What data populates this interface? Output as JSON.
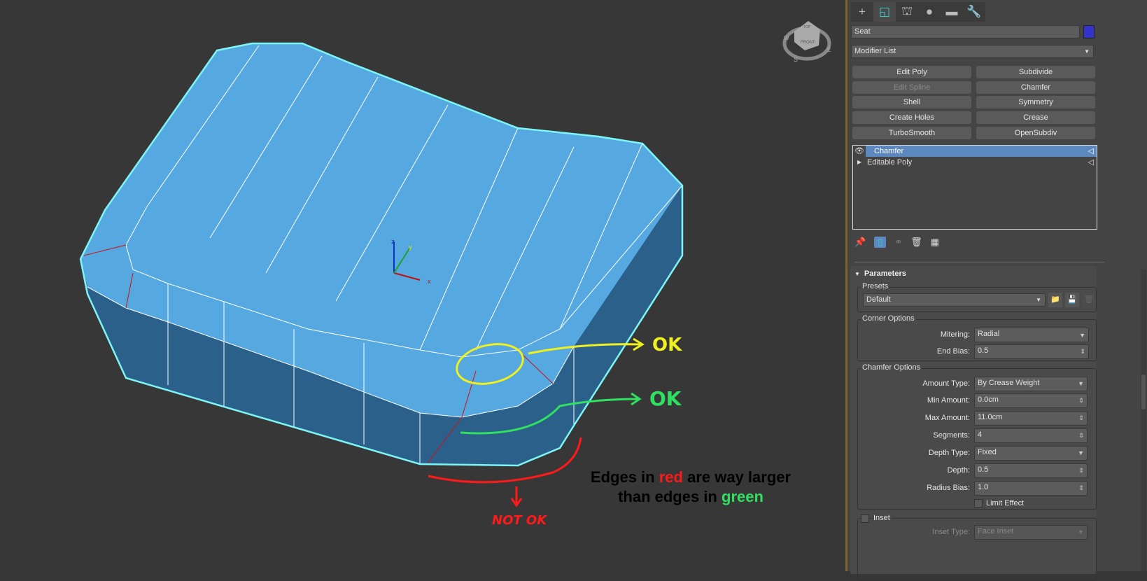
{
  "viewport": {
    "viewcube": {
      "face_top": "TOP",
      "face_front": "FRONT",
      "compass_w": "W",
      "compass_s": "S",
      "compass_e": "E"
    },
    "gizmo": {
      "x": "x",
      "y": "y",
      "z": "z"
    },
    "annotations": {
      "ok_yellow": "OK",
      "ok_green": "OK",
      "not_ok": "NOT OK",
      "note_part1": "Edges in ",
      "note_red": "red",
      "note_part2": " are way larger",
      "note_line2": "than edges in ",
      "note_green": "green"
    },
    "colors": {
      "top_face": "#56a8e0",
      "side_face": "#2a6089",
      "selection_outline": "#7ef5f5",
      "yellow": "#f0f020",
      "green": "#30e060",
      "red": "#ff1a1a"
    }
  },
  "panel": {
    "tabs": [
      {
        "icon": "plus-icon",
        "glyph": "+"
      },
      {
        "icon": "modify-icon",
        "glyph": "◱"
      },
      {
        "icon": "hierarchy-icon",
        "glyph": "⛫"
      },
      {
        "icon": "motion-icon",
        "glyph": "●"
      },
      {
        "icon": "display-icon",
        "glyph": "▬"
      },
      {
        "icon": "utilities-icon",
        "glyph": "🔧"
      }
    ],
    "object_name": "Seat",
    "object_color": "#3333cc",
    "modifier_list": "Modifier List",
    "modifier_buttons": [
      {
        "label": "Edit Poly",
        "enabled": true
      },
      {
        "label": "Subdivide",
        "enabled": true
      },
      {
        "label": "Edit Spline",
        "enabled": false
      },
      {
        "label": "Chamfer",
        "enabled": true
      },
      {
        "label": "Shell",
        "enabled": true
      },
      {
        "label": "Symmetry",
        "enabled": true
      },
      {
        "label": "Create Holes",
        "enabled": true
      },
      {
        "label": "Crease",
        "enabled": true
      },
      {
        "label": "TurboSmooth",
        "enabled": true
      },
      {
        "label": "OpenSubdiv",
        "enabled": true
      }
    ],
    "stack": [
      {
        "label": "Chamfer",
        "selected": true
      },
      {
        "label": "Editable Poly",
        "selected": false
      }
    ],
    "parameters": {
      "title": "Parameters",
      "presets_label": "Presets",
      "preset_value": "Default",
      "corner_options": "Corner Options",
      "mitering_label": "Mitering:",
      "mitering_value": "Radial",
      "end_bias_label": "End Bias:",
      "end_bias_value": "0.5",
      "chamfer_options": "Chamfer Options",
      "amount_type_label": "Amount Type:",
      "amount_type_value": "By Crease Weight",
      "min_amount_label": "Min Amount:",
      "min_amount_value": "0.0cm",
      "max_amount_label": "Max Amount:",
      "max_amount_value": "11.0cm",
      "segments_label": "Segments:",
      "segments_value": "4",
      "depth_type_label": "Depth Type:",
      "depth_type_value": "Fixed",
      "depth_label": "Depth:",
      "depth_value": "0.5",
      "radius_bias_label": "Radius Bias:",
      "radius_bias_value": "1.0",
      "limit_effect": "Limit Effect",
      "limit_effect_checked": false,
      "inset": "Inset",
      "inset_checked": false,
      "inset_type_label": "Inset Type:",
      "inset_type_value": "Face Inset"
    }
  }
}
